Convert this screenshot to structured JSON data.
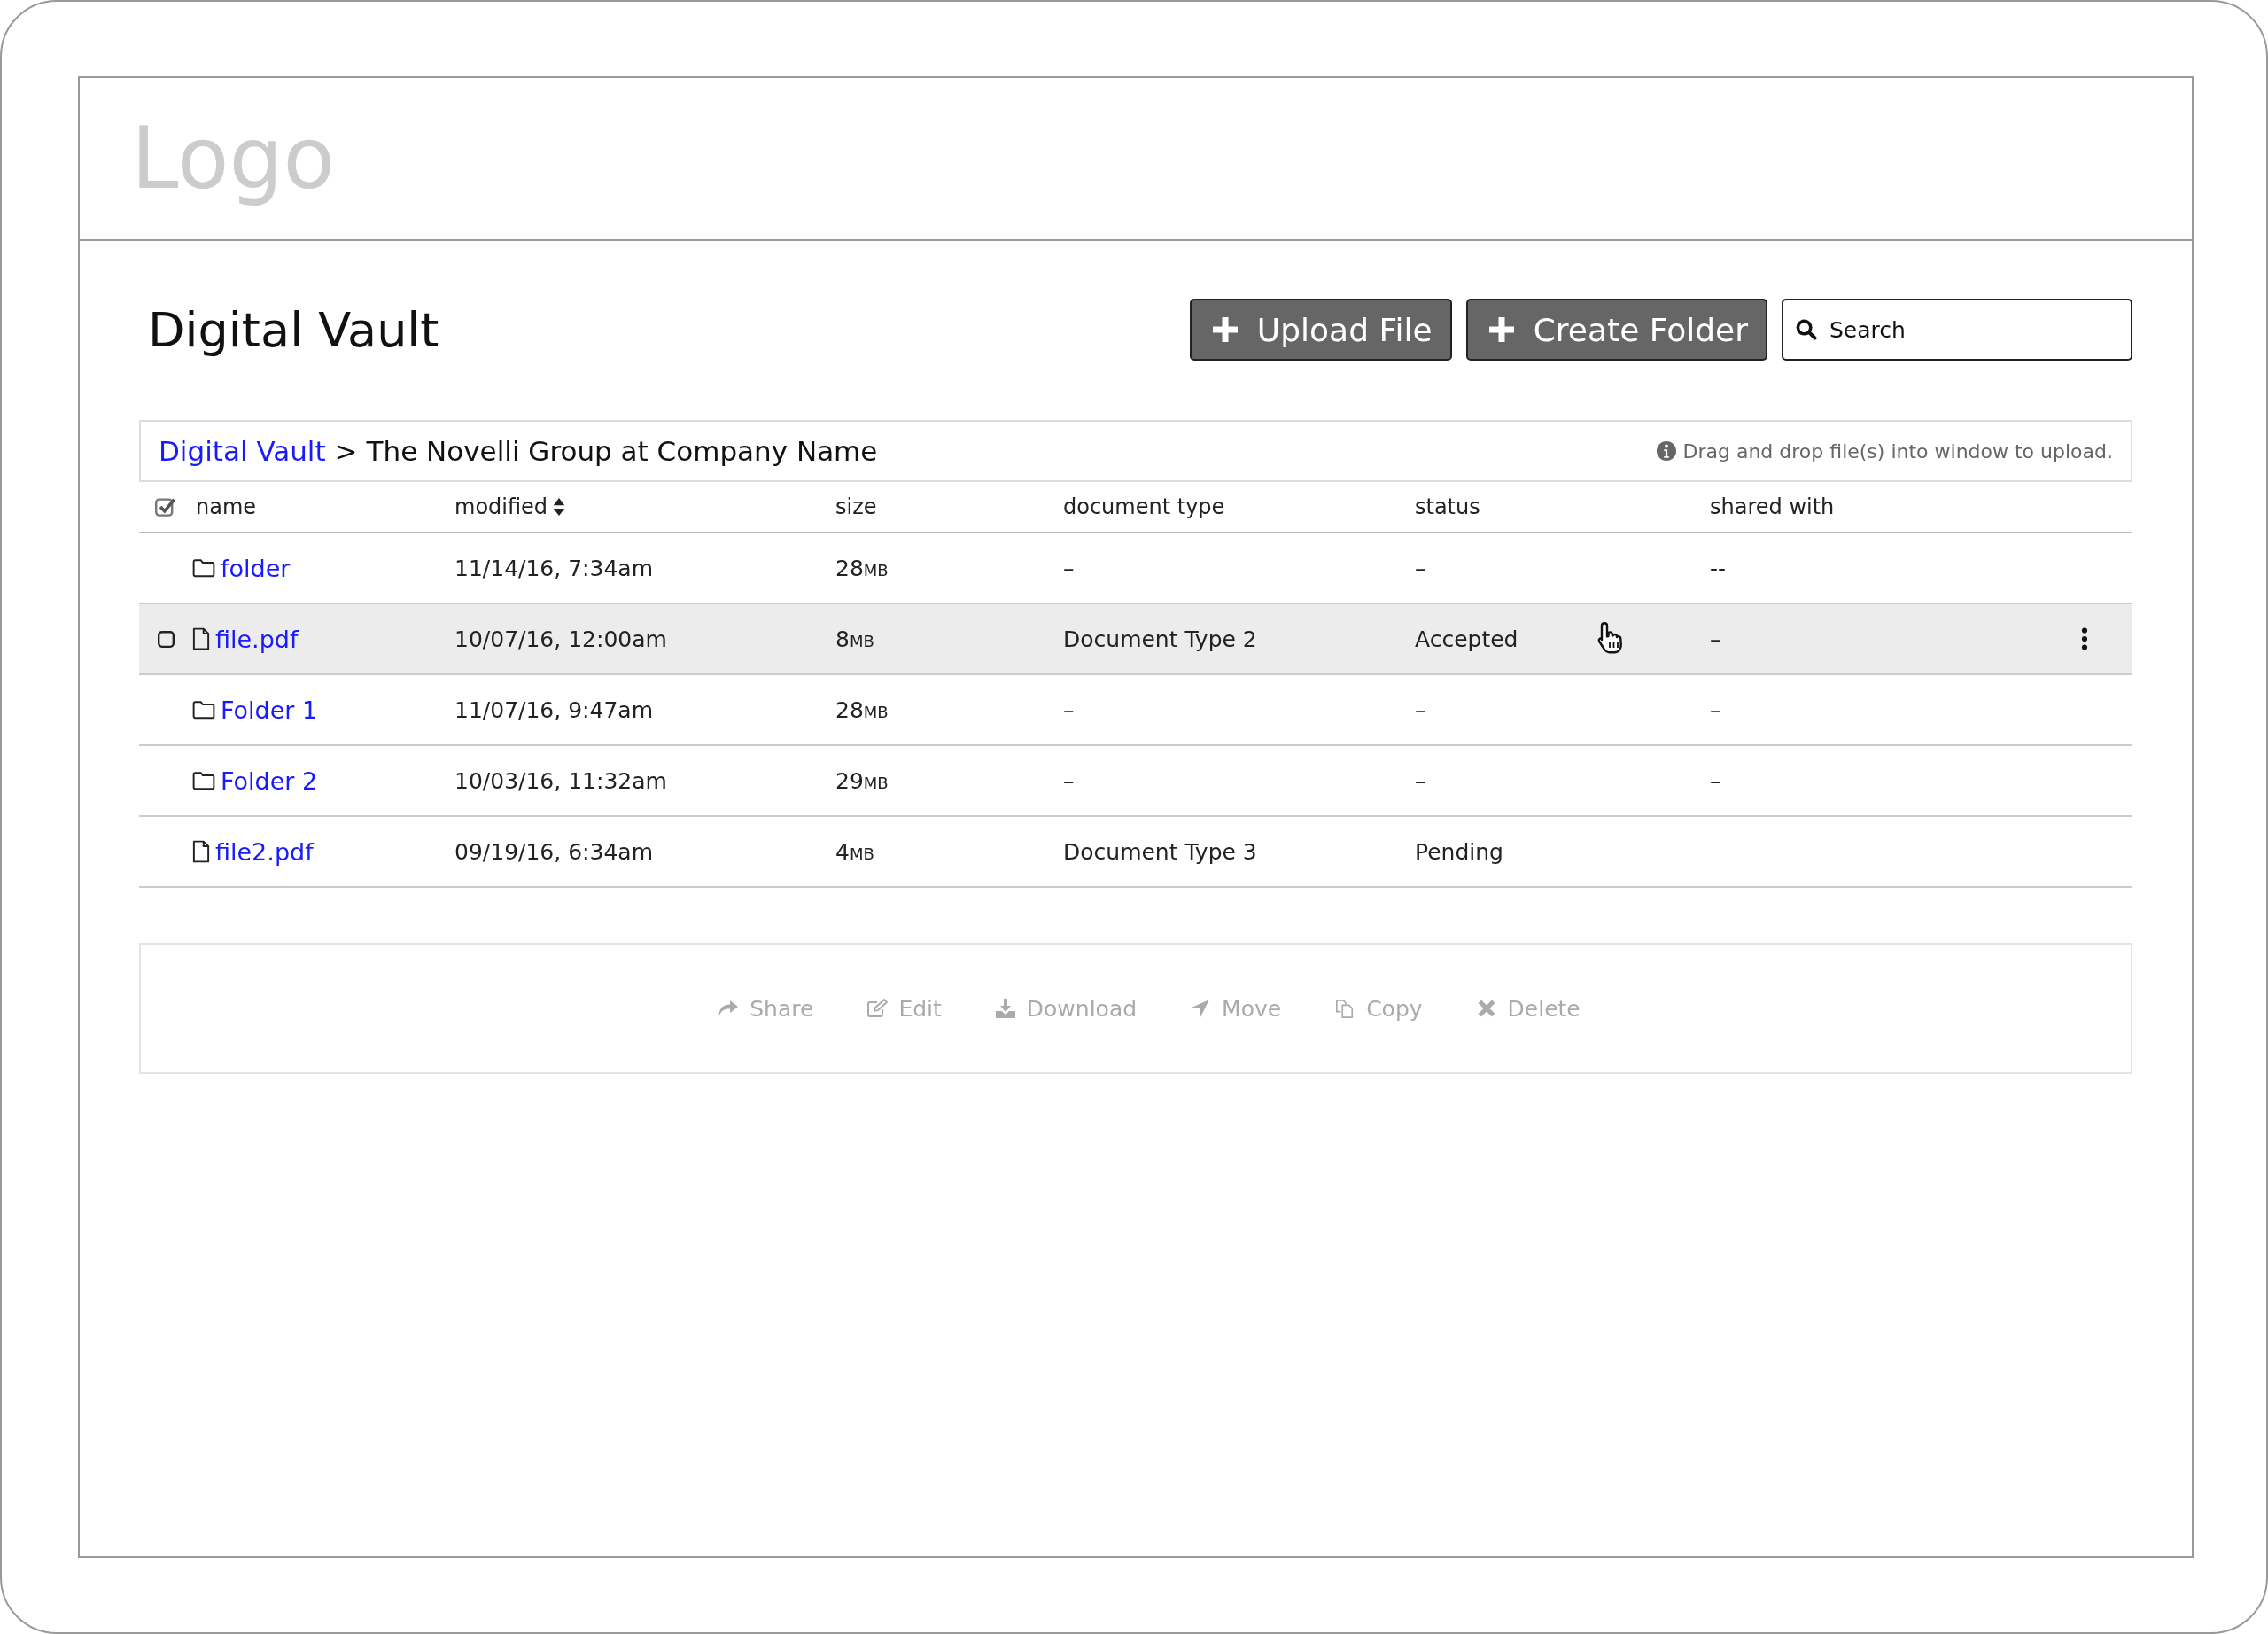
{
  "logo": "Logo",
  "title": "Digital Vault",
  "toolbar": {
    "buttons": [
      {
        "label": "Upload File"
      },
      {
        "label": "Create Folder"
      }
    ],
    "search": {
      "placeholder": "Search"
    }
  },
  "breadcrumb": {
    "link": "Digital Vault",
    "separator": ">",
    "current": "The Novelli Group at Company Name",
    "hint": "Drag and drop file(s) into window to upload."
  },
  "table": {
    "select_all": {
      "checked": true
    },
    "columns": [
      {
        "label": "name",
        "sortable": false
      },
      {
        "label": "modified",
        "sortable": true
      },
      {
        "label": "size",
        "sortable": false
      },
      {
        "label": "document type",
        "sortable": false
      },
      {
        "label": "status",
        "sortable": false
      },
      {
        "label": "shared with",
        "sortable": false
      }
    ],
    "rows": [
      {
        "kind": "folder",
        "name": "folder",
        "modified": "11/14/16, 7:34am",
        "size": "28",
        "size_unit": "MB",
        "document_type": "–",
        "status": "–",
        "shared_with": "--",
        "selected": false
      },
      {
        "kind": "file",
        "name": "file.pdf",
        "modified": "10/07/16, 12:00am",
        "size": "8",
        "size_unit": "MB",
        "document_type": "Document Type 2",
        "status": "Accepted",
        "shared_with": "–",
        "selected": true
      },
      {
        "kind": "folder",
        "name": "Folder 1",
        "modified": "11/07/16, 9:47am",
        "size": "28",
        "size_unit": "MB",
        "document_type": "–",
        "status": "–",
        "shared_with": "–",
        "selected": false
      },
      {
        "kind": "folder",
        "name": "Folder 2",
        "modified": "10/03/16, 11:32am",
        "size": "29",
        "size_unit": "MB",
        "document_type": "–",
        "status": "–",
        "shared_with": "–",
        "selected": false
      },
      {
        "kind": "file",
        "name": "file2.pdf",
        "modified": "09/19/16, 6:34am",
        "size": "4",
        "size_unit": "MB",
        "document_type": "Document Type 3",
        "status": "Pending",
        "shared_with": "",
        "selected": false
      }
    ]
  },
  "actions": [
    {
      "kind": "share",
      "label": "Share",
      "disabled": true
    },
    {
      "kind": "edit",
      "label": "Edit",
      "disabled": true
    },
    {
      "kind": "download",
      "label": "Download",
      "disabled": true
    },
    {
      "kind": "move",
      "label": "Move",
      "disabled": true
    },
    {
      "kind": "copy",
      "label": "Copy",
      "disabled": true
    },
    {
      "kind": "delete",
      "label": "Delete",
      "disabled": true
    }
  ]
}
